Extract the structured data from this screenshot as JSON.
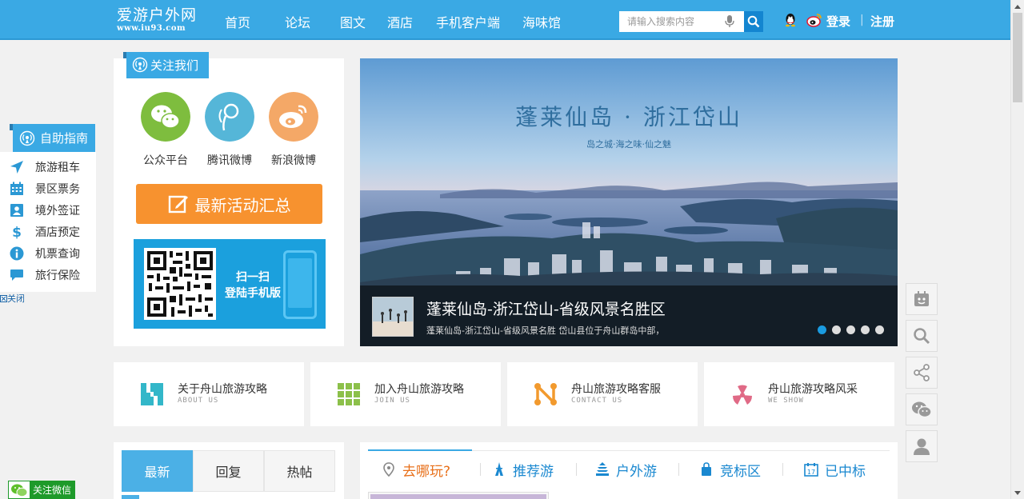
{
  "header": {
    "logo_title": "爱游户外网",
    "logo_url": "www.iu93.com",
    "nav": [
      "首页",
      "论坛",
      "图文",
      "酒店",
      "手机客户端",
      "海味馆"
    ],
    "search_placeholder": "请输入搜索内容",
    "login": "登录",
    "separator": "|",
    "register": "注册"
  },
  "guide": {
    "title": "自助指南",
    "items": [
      "旅游租车",
      "景区票务",
      "境外签证",
      "酒店预定",
      "机票查询",
      "旅行保险"
    ],
    "close": "关闭"
  },
  "follow": {
    "title": "关注我们",
    "socials": [
      "公众平台",
      "腾讯微博",
      "新浪微博"
    ],
    "activity": "最新活动汇总",
    "qr_line1": "扫一扫",
    "qr_line2": "登陆手机版"
  },
  "banner": {
    "title": "蓬莱仙岛 · 浙江岱山",
    "subtitle": "岛之城·海之味·仙之魅",
    "caption": "蓬莱仙岛-浙江岱山-省级风景名胜区",
    "desc": "蓬莱仙岛-浙江岱山-省级风景名胜 岱山县位于舟山群岛中部，",
    "slides": 5,
    "active_slide": 1
  },
  "cards": [
    {
      "title": "关于舟山旅游攻略",
      "en": "ABOUT US",
      "color": "#33b7c9"
    },
    {
      "title": "加入舟山旅游攻略",
      "en": "JOIN US",
      "color": "#8cc04a"
    },
    {
      "title": "舟山旅游攻略客服",
      "en": "CONTACT US",
      "color": "#f29a2e"
    },
    {
      "title": "舟山旅游攻略风采",
      "en": "WE SHOW",
      "color": "#e06a86"
    }
  ],
  "left_tabs": [
    "最新",
    "回复",
    "热帖"
  ],
  "right_tabs": [
    "去哪玩?",
    "推荐游",
    "户外游",
    "竞标区",
    "已中标"
  ],
  "wechat_follow": "关注微信",
  "colors": {
    "brand": "#3aa9e4",
    "orange": "#f7922f",
    "link": "#1a88d0"
  }
}
